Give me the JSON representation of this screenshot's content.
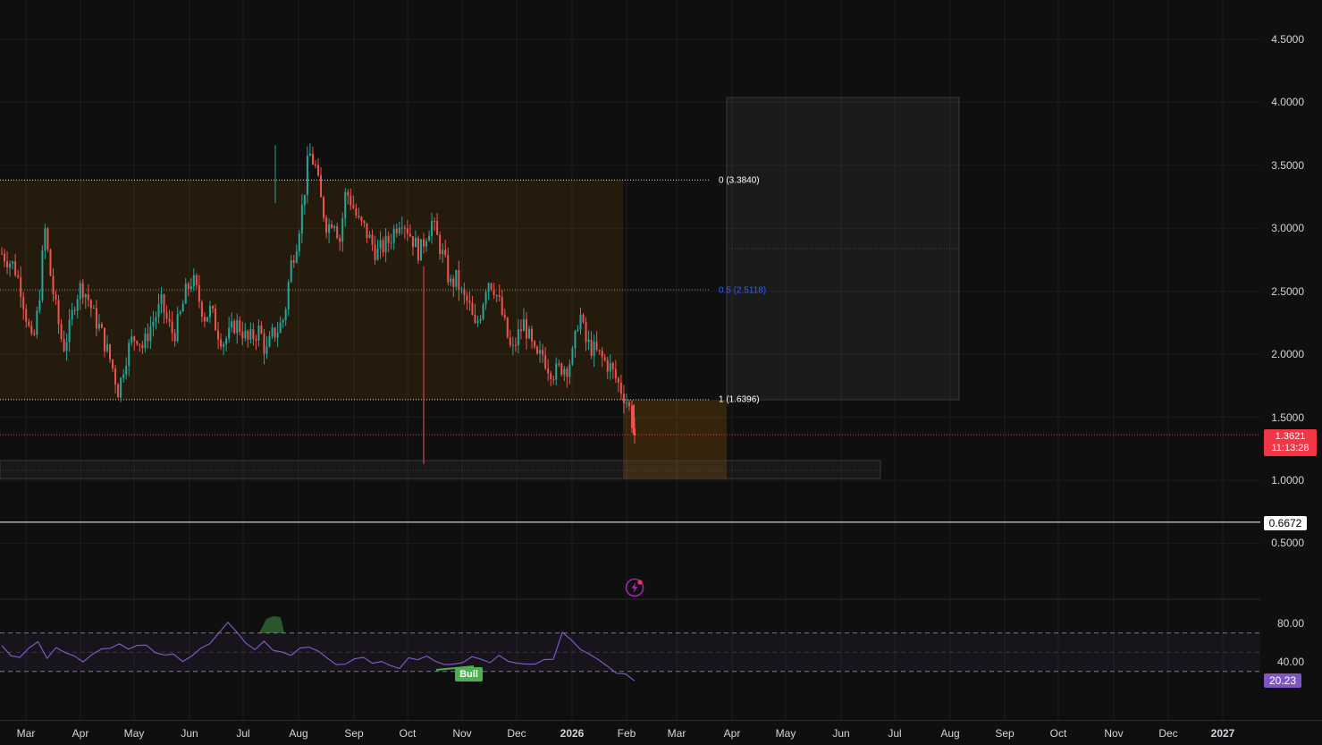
{
  "chart_data": {
    "type": "candlestick",
    "price_axis": {
      "ticks": [
        "4.5000",
        "4.0000",
        "3.5000",
        "3.0000",
        "2.5000",
        "2.0000",
        "1.5000",
        "1.0000",
        "0.5000"
      ],
      "ylim": [
        0.3,
        4.72
      ]
    },
    "time_axis": [
      {
        "label": "Mar"
      },
      {
        "label": "Apr"
      },
      {
        "label": "May"
      },
      {
        "label": "Jun"
      },
      {
        "label": "Jul"
      },
      {
        "label": "Aug"
      },
      {
        "label": "Sep"
      },
      {
        "label": "Oct"
      },
      {
        "label": "Nov"
      },
      {
        "label": "Dec"
      },
      {
        "label": "2026",
        "bold": true
      },
      {
        "label": "Feb"
      },
      {
        "label": "Mar"
      },
      {
        "label": "Apr"
      },
      {
        "label": "May"
      },
      {
        "label": "Jun"
      },
      {
        "label": "Jul"
      },
      {
        "label": "Aug"
      },
      {
        "label": "Sep"
      },
      {
        "label": "Oct"
      },
      {
        "label": "Nov"
      },
      {
        "label": "Dec"
      },
      {
        "label": "2027",
        "bold": true
      }
    ],
    "price_path": [
      [
        2.8,
        2.75
      ],
      [
        2.7,
        2.55
      ],
      [
        2.3,
        2.05
      ],
      [
        2.4,
        3.0
      ],
      [
        2.6,
        2.3
      ],
      [
        2.05,
        2.2
      ],
      [
        2.45,
        2.55
      ],
      [
        2.45,
        2.3
      ],
      [
        2.2,
        2.05
      ],
      [
        1.9,
        1.7
      ],
      [
        1.95,
        2.1
      ],
      [
        2.15,
        2.05
      ],
      [
        2.2,
        2.3
      ],
      [
        2.4,
        2.25
      ],
      [
        2.15,
        2.3
      ],
      [
        2.5,
        2.6
      ],
      [
        2.45,
        2.3
      ],
      [
        2.35,
        2.2
      ],
      [
        2.1,
        2.15
      ],
      [
        2.25,
        2.2
      ],
      [
        2.1,
        2.15
      ],
      [
        2.2,
        2.0
      ],
      [
        2.15,
        2.2
      ],
      [
        2.3,
        2.7
      ],
      [
        2.9,
        3.2
      ],
      [
        3.6,
        3.5
      ],
      [
        3.2,
        3.0
      ],
      [
        3.1,
        2.9
      ],
      [
        3.3,
        3.2
      ],
      [
        3.05,
        3.0
      ],
      [
        2.9,
        2.8
      ],
      [
        2.85,
        2.9
      ],
      [
        3.0,
        3.1
      ],
      [
        3.0,
        2.9
      ],
      [
        2.8,
        2.95
      ],
      [
        3.05,
        2.9
      ],
      [
        2.75,
        2.55
      ],
      [
        2.6,
        2.45
      ],
      [
        2.4,
        2.2
      ],
      [
        2.35,
        2.6
      ],
      [
        2.55,
        2.4
      ],
      [
        2.2,
        2.0
      ],
      [
        2.15,
        2.25
      ],
      [
        2.1,
        1.95
      ],
      [
        2.0,
        1.9
      ],
      [
        1.85,
        1.9
      ],
      [
        1.9,
        2.0
      ],
      [
        2.35,
        2.1
      ],
      [
        2.05,
        2.0
      ],
      [
        1.95,
        1.9
      ],
      [
        1.8,
        1.7
      ],
      [
        1.6,
        1.36
      ]
    ],
    "current_price": "1.3621",
    "countdown": "11:13:28",
    "horizontal_line": "0.6672",
    "fib": [
      {
        "level": "0",
        "price": 3.384,
        "label": "0 (3.3840)",
        "color": "#ffffff"
      },
      {
        "level": "0.5",
        "price": 2.5118,
        "label": "0.5 (2.5118)",
        "color": "#2962ff"
      },
      {
        "level": "1",
        "price": 1.6396,
        "label": "1 (1.6396)",
        "color": "#ffffff"
      }
    ],
    "rsi": {
      "ticks": [
        "80.00",
        "40.00"
      ],
      "upper": 70,
      "lower": 30,
      "middle": 50,
      "value": "20.23",
      "path": [
        58,
        48,
        42,
        55,
        60,
        45,
        52,
        50,
        47,
        40,
        45,
        52,
        55,
        58,
        52,
        60,
        55,
        48,
        45,
        50,
        42,
        47,
        52,
        58,
        68,
        82,
        72,
        58,
        55,
        60,
        52,
        50,
        48,
        54,
        58,
        52,
        45,
        40,
        38,
        45,
        42,
        36,
        40,
        38,
        35,
        42,
        44,
        45,
        40,
        38,
        36,
        42,
        48,
        40,
        38,
        45,
        40,
        36,
        35,
        40,
        44,
        40,
        68,
        60,
        55,
        48,
        42,
        38,
        30,
        28,
        20.23
      ],
      "bull_label": "Bull"
    }
  }
}
